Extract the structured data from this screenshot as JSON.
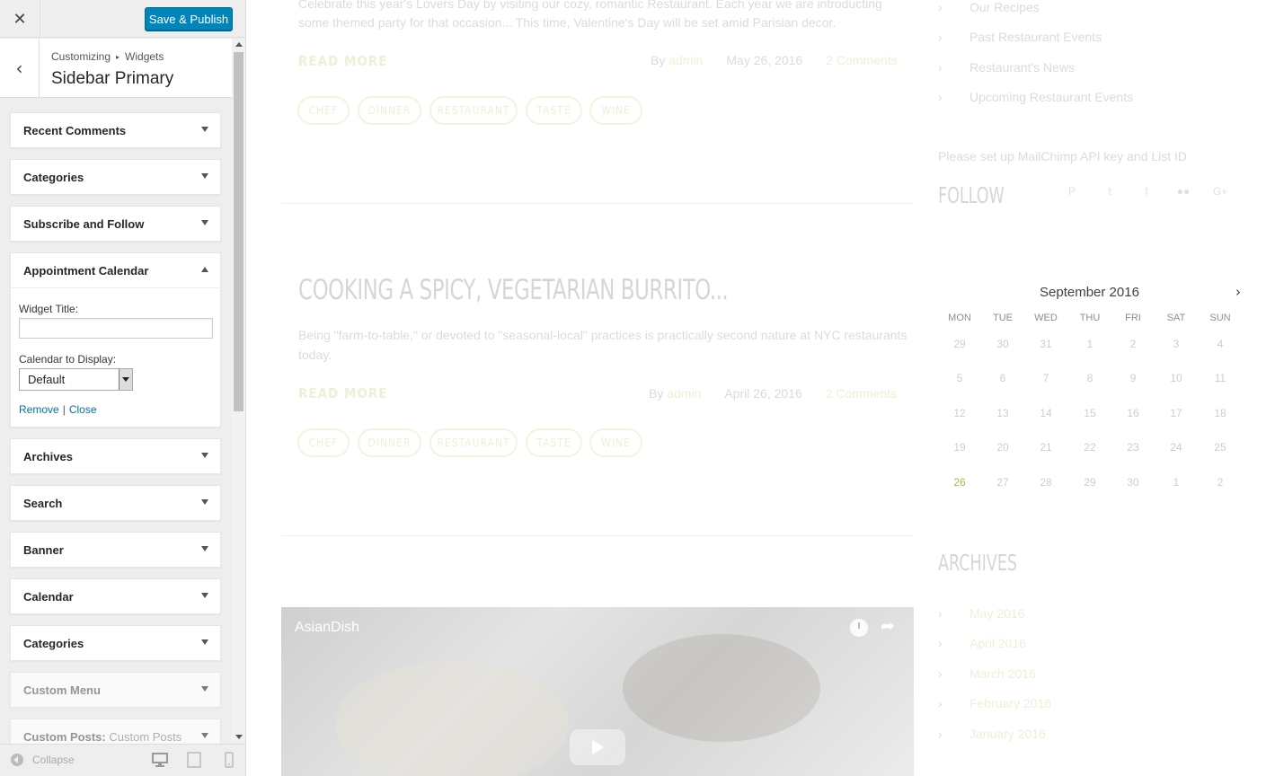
{
  "header": {
    "close_icon": "close-icon",
    "publish_label": "Save & Publish",
    "breadcrumb_root": "Customizing",
    "breadcrumb_section": "Widgets",
    "section_title": "Sidebar Primary"
  },
  "widgets": [
    {
      "title": "Recent Comments",
      "subtitle": ""
    },
    {
      "title": "Categories",
      "subtitle": ""
    },
    {
      "title": "Subscribe and Follow",
      "subtitle": ""
    },
    {
      "title": "Appointment Calendar",
      "subtitle": ""
    },
    {
      "title": "Archives",
      "subtitle": ""
    },
    {
      "title": "Search",
      "subtitle": ""
    },
    {
      "title": "Banner",
      "subtitle": ""
    },
    {
      "title": "Calendar",
      "subtitle": ""
    },
    {
      "title": "Categories",
      "subtitle": ""
    },
    {
      "title": "Custom Menu",
      "subtitle": ""
    },
    {
      "title": "Custom Posts:",
      "subtitle": "Custom Posts"
    }
  ],
  "open_widget": {
    "widget_title_label": "Widget Title:",
    "widget_title_value": "",
    "calendar_label": "Calendar to Display:",
    "calendar_selected": "Default",
    "remove_label": "Remove",
    "separator": "|",
    "close_label": "Close"
  },
  "footer": {
    "collapse_label": "Collapse",
    "devices": [
      "desktop",
      "tablet",
      "mobile"
    ]
  },
  "preview": {
    "post1": {
      "excerpt_line1": "Celebrate this year's Lovers Day by visiting our cozy, romantic Restaurant. Each year we are introducting",
      "excerpt_line2": "some themed party for that occasion... This time, Valentine's Day will be set amid Parisian decor.",
      "read_more": "READ MORE",
      "by": "By",
      "author": "admin",
      "date": "May 26, 2016",
      "comments": "2 Comments",
      "tags": [
        "CHEF",
        "DINNER",
        "RESTAURANT",
        "TASTE",
        "WINE"
      ]
    },
    "post2": {
      "title": "COOKING A SPICY, VEGETARIAN BURRITO...",
      "excerpt_line1": "Being \"farm-to-table,\" or devoted to \"seasonal-local\" practices is practically second nature at NYC restaurants",
      "excerpt_line2": "today.",
      "read_more": "READ MORE",
      "by": "By",
      "author": "admin",
      "date": "April 26, 2016",
      "comments": "2 Comments",
      "tags": [
        "CHEF",
        "DINNER",
        "RESTAURANT",
        "TASTE",
        "WINE"
      ]
    },
    "sidebar_links": [
      "Our Recipes",
      "Past Restaurant Events",
      "Restaurant's News",
      "Upcoming Restaurant Events"
    ],
    "mailchimp_note": "Please set up MailChimp API key and List ID",
    "follow_heading": "FOLLOW",
    "calendar": {
      "month": "September 2016",
      "next_icon": "chevron-right-icon",
      "weekdays": [
        "MON",
        "TUE",
        "WED",
        "THU",
        "FRI",
        "SAT",
        "SUN"
      ],
      "weeks": [
        [
          "29",
          "30",
          "31",
          "1",
          "2",
          "3",
          "4"
        ],
        [
          "5",
          "6",
          "7",
          "8",
          "9",
          "10",
          "11"
        ],
        [
          "12",
          "13",
          "14",
          "15",
          "16",
          "17",
          "18"
        ],
        [
          "19",
          "20",
          "21",
          "22",
          "23",
          "24",
          "25"
        ],
        [
          "26",
          "27",
          "28",
          "29",
          "30",
          "1",
          "2"
        ]
      ]
    },
    "archives_heading": "ARCHIVES",
    "archives": [
      "May 2016",
      "April 2016",
      "March 2016",
      "February 2016",
      "January 2016"
    ],
    "video_title": "AsianDish"
  },
  "colors": {
    "publish_button": "#0085ba",
    "link": "#0073aa",
    "accent": "#9aa000"
  }
}
